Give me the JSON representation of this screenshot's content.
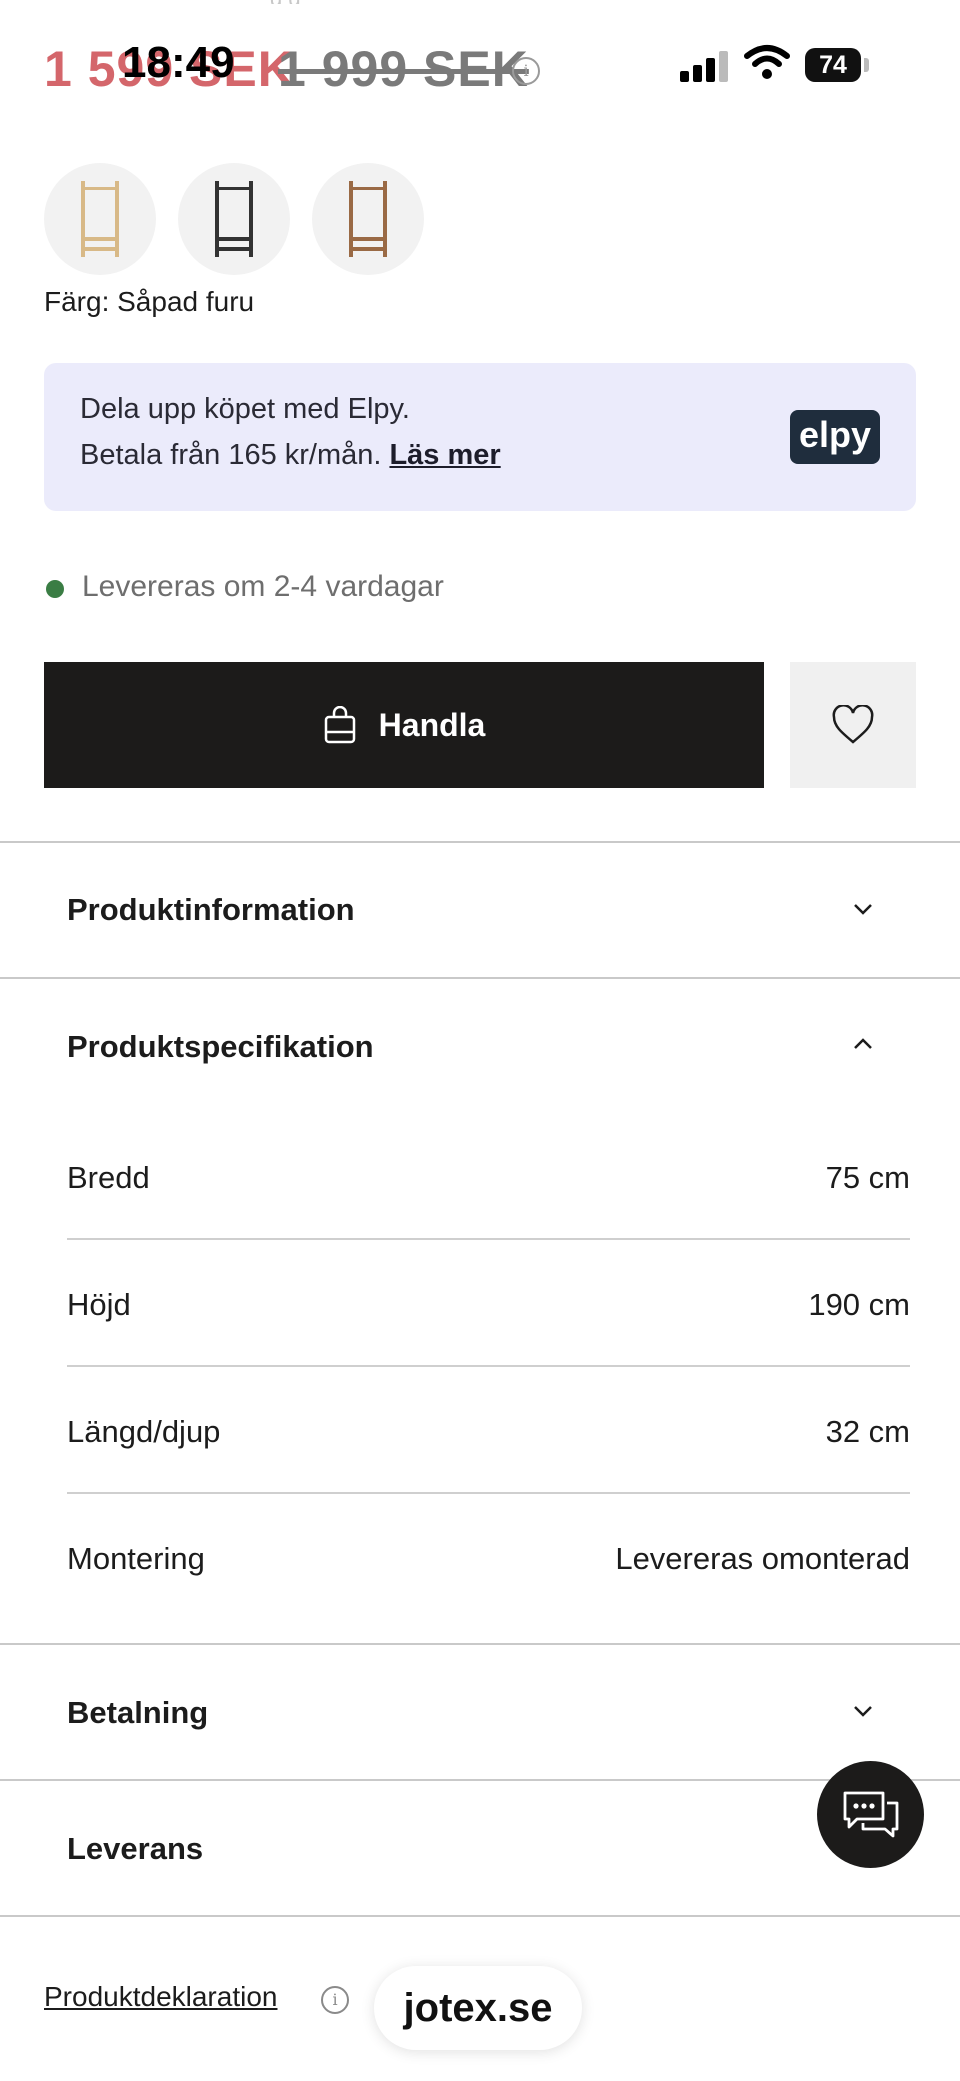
{
  "status_bar": {
    "time": "18:49",
    "battery": "74"
  },
  "header_ghost_text": "g                    g",
  "price": {
    "current": "1 599 SEK",
    "original": "1 999 SEK",
    "info_icon": "info-icon"
  },
  "color": {
    "label": "Färg: Såpad furu",
    "swatches": [
      "Såpad furu",
      "Svart",
      "Brun"
    ]
  },
  "elpy": {
    "line1": "Dela upp köpet med Elpy.",
    "line2": "Betala från 165 kr/mån.",
    "link": "Läs mer",
    "logo": "elpy"
  },
  "delivery": {
    "text": "Levereras om 2-4 vardagar",
    "status_color": "#3a7d44"
  },
  "actions": {
    "buy_label": "Handla"
  },
  "accordion": {
    "product_info": "Produktinformation",
    "product_spec": "Produktspecifikation",
    "specs": [
      {
        "label": "Bredd",
        "value": "75 cm"
      },
      {
        "label": "Höjd",
        "value": "190 cm"
      },
      {
        "label": "Längd/djup",
        "value": "32 cm"
      },
      {
        "label": "Montering",
        "value": "Levereras omonterad"
      }
    ],
    "payment": "Betalning",
    "shipping": "Leverans"
  },
  "footer": {
    "declaration": "Produktdeklaration",
    "url": "jotex.se"
  },
  "colors": {
    "sale_price": "#d4666b",
    "buy_button": "#1c1b1a",
    "elpy_bg": "#ebebfb"
  }
}
